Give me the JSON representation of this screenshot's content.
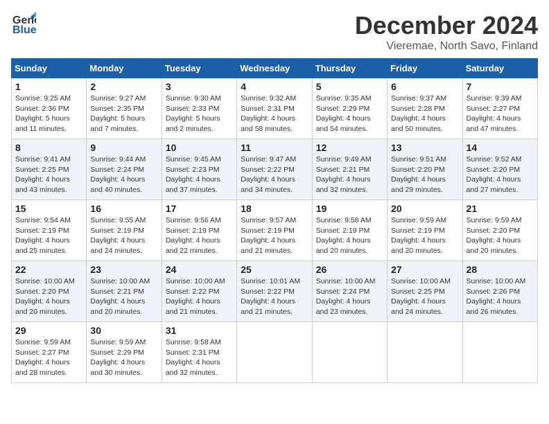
{
  "logo": {
    "line1": "General",
    "line2": "Blue"
  },
  "title": "December 2024",
  "subtitle": "Vieremae, North Savo, Finland",
  "days_of_week": [
    "Sunday",
    "Monday",
    "Tuesday",
    "Wednesday",
    "Thursday",
    "Friday",
    "Saturday"
  ],
  "weeks": [
    [
      {
        "day": "1",
        "sunrise": "Sunrise: 9:25 AM",
        "sunset": "Sunset: 2:36 PM",
        "daylight": "Daylight: 5 hours and 11 minutes."
      },
      {
        "day": "2",
        "sunrise": "Sunrise: 9:27 AM",
        "sunset": "Sunset: 2:35 PM",
        "daylight": "Daylight: 5 hours and 7 minutes."
      },
      {
        "day": "3",
        "sunrise": "Sunrise: 9:30 AM",
        "sunset": "Sunset: 2:33 PM",
        "daylight": "Daylight: 5 hours and 2 minutes."
      },
      {
        "day": "4",
        "sunrise": "Sunrise: 9:32 AM",
        "sunset": "Sunset: 2:31 PM",
        "daylight": "Daylight: 4 hours and 58 minutes."
      },
      {
        "day": "5",
        "sunrise": "Sunrise: 9:35 AM",
        "sunset": "Sunset: 2:29 PM",
        "daylight": "Daylight: 4 hours and 54 minutes."
      },
      {
        "day": "6",
        "sunrise": "Sunrise: 9:37 AM",
        "sunset": "Sunset: 2:28 PM",
        "daylight": "Daylight: 4 hours and 50 minutes."
      },
      {
        "day": "7",
        "sunrise": "Sunrise: 9:39 AM",
        "sunset": "Sunset: 2:27 PM",
        "daylight": "Daylight: 4 hours and 47 minutes."
      }
    ],
    [
      {
        "day": "8",
        "sunrise": "Sunrise: 9:41 AM",
        "sunset": "Sunset: 2:25 PM",
        "daylight": "Daylight: 4 hours and 43 minutes."
      },
      {
        "day": "9",
        "sunrise": "Sunrise: 9:44 AM",
        "sunset": "Sunset: 2:24 PM",
        "daylight": "Daylight: 4 hours and 40 minutes."
      },
      {
        "day": "10",
        "sunrise": "Sunrise: 9:45 AM",
        "sunset": "Sunset: 2:23 PM",
        "daylight": "Daylight: 4 hours and 37 minutes."
      },
      {
        "day": "11",
        "sunrise": "Sunrise: 9:47 AM",
        "sunset": "Sunset: 2:22 PM",
        "daylight": "Daylight: 4 hours and 34 minutes."
      },
      {
        "day": "12",
        "sunrise": "Sunrise: 9:49 AM",
        "sunset": "Sunset: 2:21 PM",
        "daylight": "Daylight: 4 hours and 32 minutes."
      },
      {
        "day": "13",
        "sunrise": "Sunrise: 9:51 AM",
        "sunset": "Sunset: 2:20 PM",
        "daylight": "Daylight: 4 hours and 29 minutes."
      },
      {
        "day": "14",
        "sunrise": "Sunrise: 9:52 AM",
        "sunset": "Sunset: 2:20 PM",
        "daylight": "Daylight: 4 hours and 27 minutes."
      }
    ],
    [
      {
        "day": "15",
        "sunrise": "Sunrise: 9:54 AM",
        "sunset": "Sunset: 2:19 PM",
        "daylight": "Daylight: 4 hours and 25 minutes."
      },
      {
        "day": "16",
        "sunrise": "Sunrise: 9:55 AM",
        "sunset": "Sunset: 2:19 PM",
        "daylight": "Daylight: 4 hours and 24 minutes."
      },
      {
        "day": "17",
        "sunrise": "Sunrise: 9:56 AM",
        "sunset": "Sunset: 2:19 PM",
        "daylight": "Daylight: 4 hours and 22 minutes."
      },
      {
        "day": "18",
        "sunrise": "Sunrise: 9:57 AM",
        "sunset": "Sunset: 2:19 PM",
        "daylight": "Daylight: 4 hours and 21 minutes."
      },
      {
        "day": "19",
        "sunrise": "Sunrise: 9:58 AM",
        "sunset": "Sunset: 2:19 PM",
        "daylight": "Daylight: 4 hours and 20 minutes."
      },
      {
        "day": "20",
        "sunrise": "Sunrise: 9:59 AM",
        "sunset": "Sunset: 2:19 PM",
        "daylight": "Daylight: 4 hours and 20 minutes."
      },
      {
        "day": "21",
        "sunrise": "Sunrise: 9:59 AM",
        "sunset": "Sunset: 2:20 PM",
        "daylight": "Daylight: 4 hours and 20 minutes."
      }
    ],
    [
      {
        "day": "22",
        "sunrise": "Sunrise: 10:00 AM",
        "sunset": "Sunset: 2:20 PM",
        "daylight": "Daylight: 4 hours and 20 minutes."
      },
      {
        "day": "23",
        "sunrise": "Sunrise: 10:00 AM",
        "sunset": "Sunset: 2:21 PM",
        "daylight": "Daylight: 4 hours and 20 minutes."
      },
      {
        "day": "24",
        "sunrise": "Sunrise: 10:00 AM",
        "sunset": "Sunset: 2:22 PM",
        "daylight": "Daylight: 4 hours and 21 minutes."
      },
      {
        "day": "25",
        "sunrise": "Sunrise: 10:01 AM",
        "sunset": "Sunset: 2:22 PM",
        "daylight": "Daylight: 4 hours and 21 minutes."
      },
      {
        "day": "26",
        "sunrise": "Sunrise: 10:00 AM",
        "sunset": "Sunset: 2:24 PM",
        "daylight": "Daylight: 4 hours and 23 minutes."
      },
      {
        "day": "27",
        "sunrise": "Sunrise: 10:00 AM",
        "sunset": "Sunset: 2:25 PM",
        "daylight": "Daylight: 4 hours and 24 minutes."
      },
      {
        "day": "28",
        "sunrise": "Sunrise: 10:00 AM",
        "sunset": "Sunset: 2:26 PM",
        "daylight": "Daylight: 4 hours and 26 minutes."
      }
    ],
    [
      {
        "day": "29",
        "sunrise": "Sunrise: 9:59 AM",
        "sunset": "Sunset: 2:27 PM",
        "daylight": "Daylight: 4 hours and 28 minutes."
      },
      {
        "day": "30",
        "sunrise": "Sunrise: 9:59 AM",
        "sunset": "Sunset: 2:29 PM",
        "daylight": "Daylight: 4 hours and 30 minutes."
      },
      {
        "day": "31",
        "sunrise": "Sunrise: 9:58 AM",
        "sunset": "Sunset: 2:31 PM",
        "daylight": "Daylight: 4 hours and 32 minutes."
      },
      null,
      null,
      null,
      null
    ]
  ]
}
